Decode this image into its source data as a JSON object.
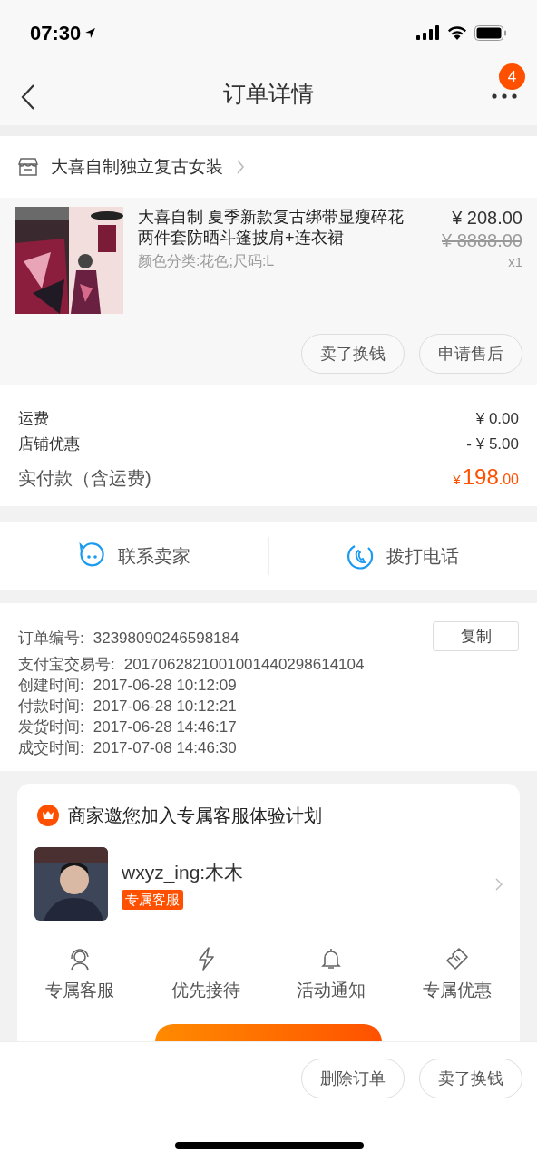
{
  "status_bar": {
    "time": "07:30"
  },
  "nav": {
    "title": "订单详情",
    "badge": "4"
  },
  "shop": {
    "name": "大喜自制独立复古女装"
  },
  "product": {
    "title": "大喜自制 夏季新款复古绑带显瘦碎花两件套防晒斗篷披肩+连衣裙",
    "spec": "颜色分类:花色;尺码:L",
    "price": "¥ 208.00",
    "original_price": "¥ 8888.00",
    "quantity": "x1",
    "actions": [
      "卖了换钱",
      "申请售后"
    ]
  },
  "costs": [
    {
      "label": "运费",
      "value": "¥ 0.00"
    },
    {
      "label": "店铺优惠",
      "value": "- ¥ 5.00"
    }
  ],
  "total": {
    "label": "实付款（含运费)",
    "currency": "¥",
    "integer": "198",
    "decimal": ".00"
  },
  "contact": [
    {
      "kind": "chat",
      "label": "联系卖家"
    },
    {
      "kind": "phone",
      "label": "拨打电话"
    }
  ],
  "order_info": {
    "copy_button": "复制",
    "rows": [
      {
        "label": "订单编号:",
        "value": "32398090246598184"
      },
      {
        "label": "支付宝交易号:",
        "value": "2017062821001001440298614104"
      },
      {
        "label": "创建时间:",
        "value": "2017-06-28 10:12:09"
      },
      {
        "label": "付款时间:",
        "value": "2017-06-28 10:12:21"
      },
      {
        "label": "发货时间:",
        "value": "2017-06-28 14:46:17"
      },
      {
        "label": "成交时间:",
        "value": "2017-07-08 14:46:30"
      }
    ]
  },
  "invite_card": {
    "title": "商家邀您加入专属客服体验计划",
    "agent": {
      "name": "wxyz_ing:木木",
      "tag": "专属客服"
    },
    "benefits": [
      {
        "kind": "agent",
        "label": "专属客服"
      },
      {
        "kind": "bolt",
        "label": "优先接待"
      },
      {
        "kind": "bell",
        "label": "活动通知"
      },
      {
        "kind": "ticket",
        "label": "专属优惠"
      }
    ]
  },
  "bottom_actions": [
    "删除订单",
    "卖了换钱"
  ]
}
